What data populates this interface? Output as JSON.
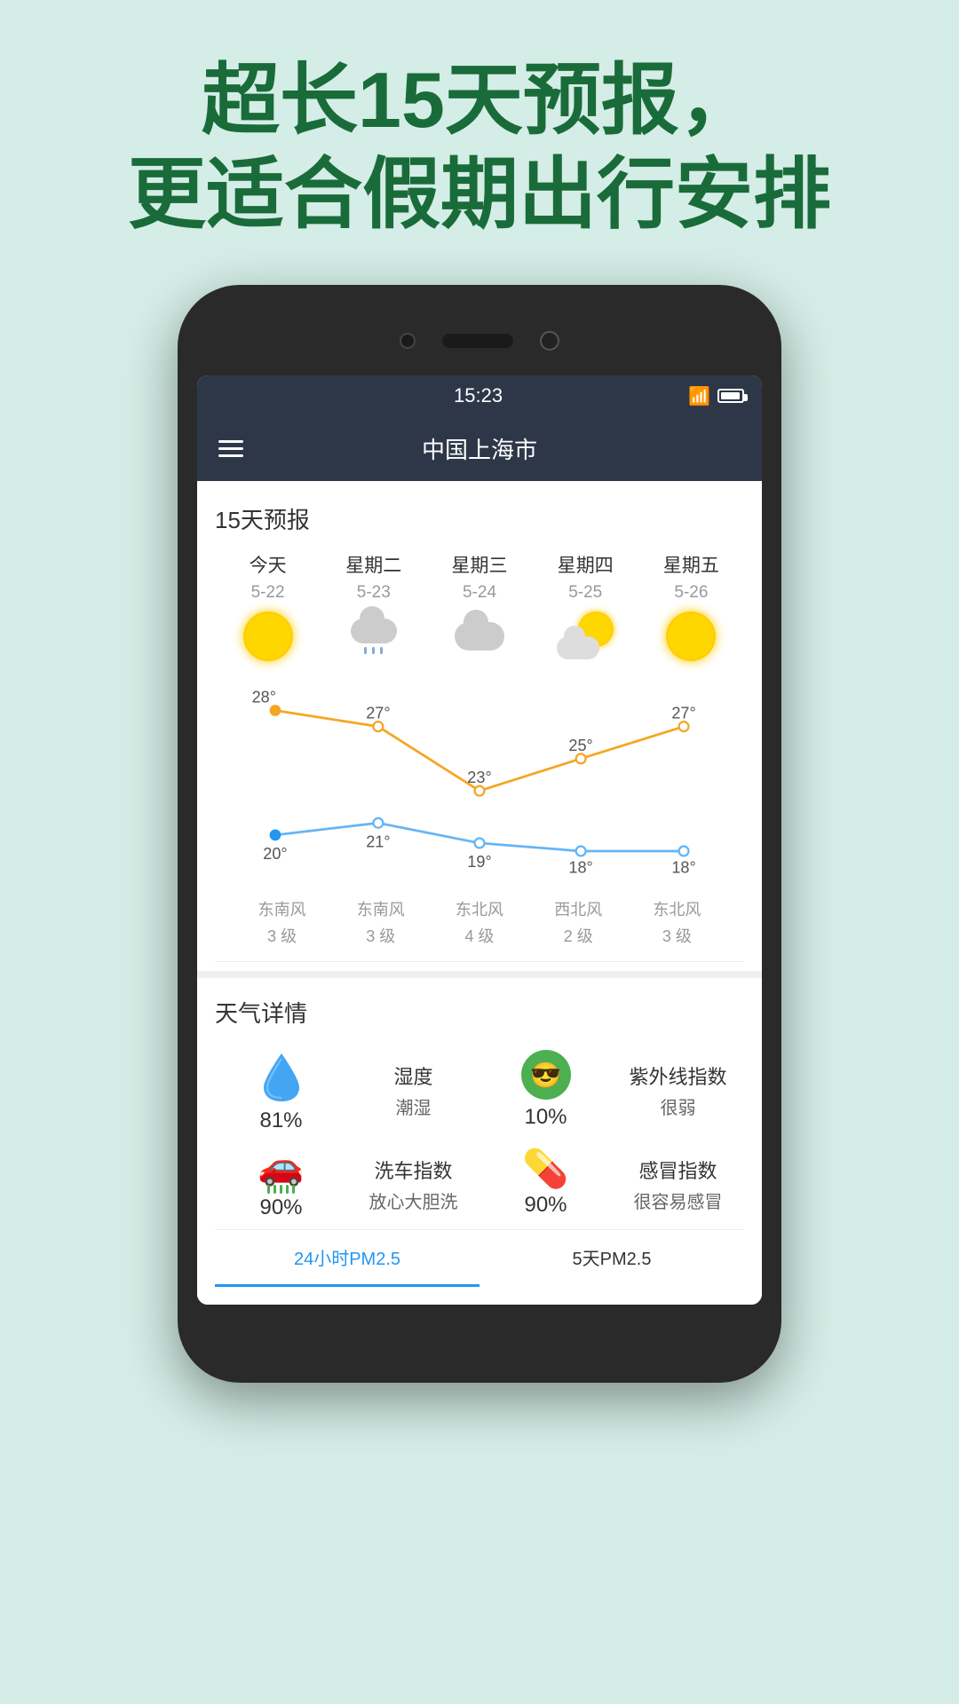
{
  "page": {
    "bg_color": "#d4ede6",
    "headline_line1": "超长15天预报，",
    "headline_line2": "更适合假期出行安排"
  },
  "status_bar": {
    "time": "15:23",
    "wifi": "wifi",
    "battery": "battery"
  },
  "toolbar": {
    "menu_label": "≡",
    "city": "中国上海市"
  },
  "forecast": {
    "section_title": "15天预报",
    "days": [
      {
        "name": "今天",
        "date": "5-22",
        "icon": "sun",
        "high": "28",
        "low": "20",
        "wind_dir": "东南风",
        "wind_level": "3 级"
      },
      {
        "name": "星期二",
        "date": "5-23",
        "icon": "cloud-rain",
        "high": "27",
        "low": "21",
        "wind_dir": "东南风",
        "wind_level": "3 级"
      },
      {
        "name": "星期三",
        "date": "5-24",
        "icon": "cloud",
        "high": "23",
        "low": "19",
        "wind_dir": "东北风",
        "wind_level": "4 级"
      },
      {
        "name": "星期四",
        "date": "5-25",
        "icon": "partly-cloudy",
        "high": "25",
        "low": "18",
        "wind_dir": "西北风",
        "wind_level": "2 级"
      },
      {
        "name": "星期五",
        "date": "5-26",
        "icon": "sun",
        "high": "27",
        "low": "18",
        "wind_dir": "东北风",
        "wind_level": "3 级"
      }
    ]
  },
  "details": {
    "section_title": "天气详情",
    "items": [
      {
        "icon": "water-drop",
        "label": "",
        "value": "81%"
      },
      {
        "icon": "",
        "label": "湿度",
        "sublabel": "潮湿",
        "value": ""
      },
      {
        "icon": "sunglasses",
        "label": "紫外线指数",
        "value": "10%",
        "sublabel": "很弱"
      },
      {
        "icon": "car-wash",
        "label": "",
        "value": "90%"
      },
      {
        "icon": "",
        "label": "洗车指数",
        "sublabel": "放心大胆洗",
        "value": ""
      },
      {
        "icon": "pill",
        "label": "感冒指数",
        "value": "90%",
        "sublabel": "很容易感冒"
      }
    ]
  },
  "bottom_tabs": [
    {
      "label": "24小时PM2.5",
      "active": true
    },
    {
      "label": "5天PM2.5",
      "active": false
    }
  ]
}
